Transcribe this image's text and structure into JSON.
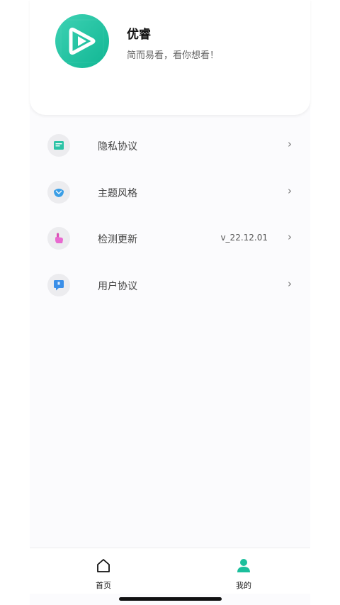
{
  "profile": {
    "name": "优睿",
    "slogan": "简而易看，看你想看！"
  },
  "menu": {
    "items": [
      {
        "label": "隐私协议",
        "value": "",
        "icon": "privacy-document-icon"
      },
      {
        "label": "主题风格",
        "value": "",
        "icon": "theme-palette-icon"
      },
      {
        "label": "检测更新",
        "value": "v_22.12.01",
        "icon": "update-hand-icon"
      },
      {
        "label": "用户协议",
        "value": "",
        "icon": "agreement-chat-icon"
      }
    ],
    "chevron": "›"
  },
  "tabbar": {
    "home_label": "首页",
    "mine_label": "我的",
    "active_color": "#1bbf9c"
  },
  "colors": {
    "brand": "#1bbf9c"
  }
}
